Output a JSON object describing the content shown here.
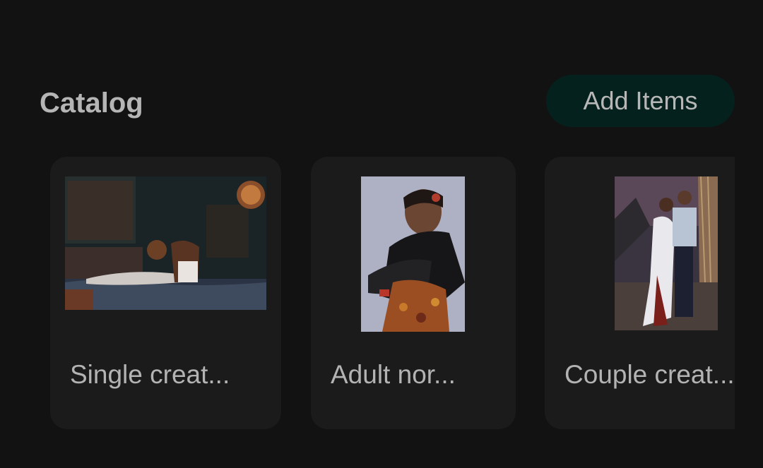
{
  "header": {
    "title": "Catalog",
    "add_button_label": "Add Items"
  },
  "catalog": {
    "items": [
      {
        "label": "Single creat...",
        "image": "woman-lying-on-bed-photo"
      },
      {
        "label": "Adult nor...",
        "image": "woman-portrait-black-feather-photo"
      },
      {
        "label": "Couple creat...",
        "image": "couple-standing-back-to-back-photo"
      }
    ]
  },
  "colors": {
    "background": "#121212",
    "card": "#1b1b1b",
    "button": "#05211d",
    "text": "#b5b5b5"
  }
}
